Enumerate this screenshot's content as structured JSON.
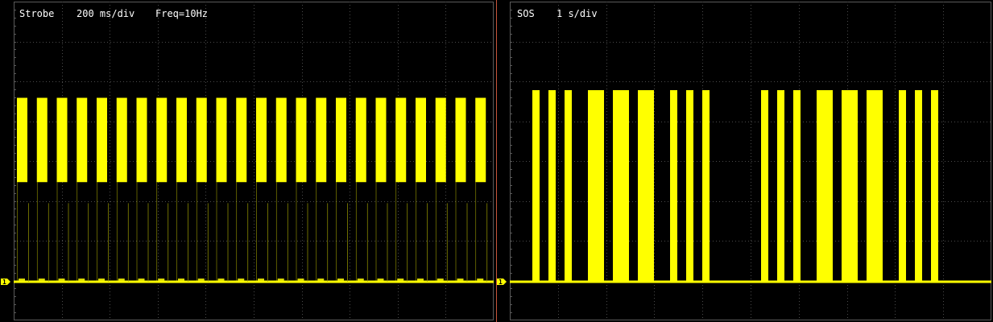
{
  "trace_color": "#ffff00",
  "separator_color": "#c8553a",
  "channel_marker": "1",
  "chart_data": [
    {
      "type": "line",
      "title": "Strobe",
      "timebase": "200 ms/div",
      "measurement": "Freq=10Hz",
      "pulse_pattern": "periodic",
      "pulse_count": 24,
      "pulse_period_s": 0.1,
      "pulse_width_s": 0.04,
      "high_band": [
        0.52,
        0.96
      ],
      "residual_spike": 0.41,
      "baseline": 0,
      "ylim": [
        -0.1,
        1.35
      ],
      "grid": true
    },
    {
      "type": "line",
      "title": "SOS",
      "timebase": "1 s/div",
      "pulse_pattern": "morse",
      "message": "SOS SOS",
      "high": 1.0,
      "baseline": 0,
      "ylim": [
        -0.1,
        1.35
      ],
      "grid": true
    }
  ]
}
